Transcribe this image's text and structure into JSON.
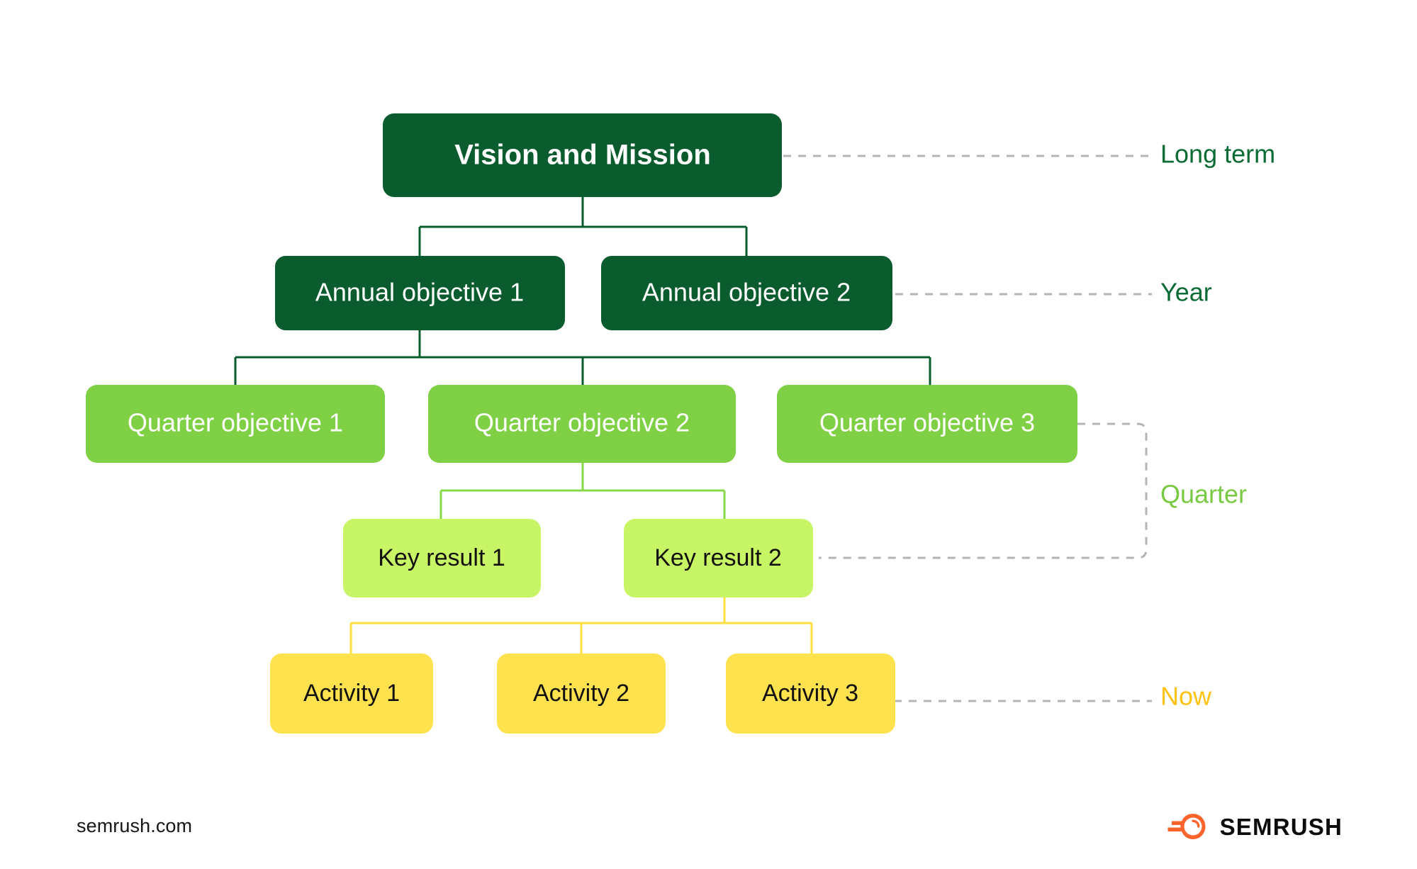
{
  "diagram": {
    "title_semantics": "OKR cascade hierarchy",
    "levels": [
      {
        "id": "vision",
        "time_label": "Long term",
        "label_color": "#0a6b34",
        "box_fill": "#0a5c2e",
        "text_color": "#ffffff",
        "nodes": [
          {
            "label": "Vision and Mission"
          }
        ]
      },
      {
        "id": "annual",
        "time_label": "Year",
        "label_color": "#0a6b34",
        "box_fill": "#0a5c2e",
        "text_color": "#ffffff",
        "nodes": [
          {
            "label": "Annual objective 1"
          },
          {
            "label": "Annual objective 2"
          }
        ]
      },
      {
        "id": "quarter",
        "time_label": "Quarter",
        "label_color": "#7ac943",
        "box_fill": "#80d046",
        "text_color": "#ffffff",
        "nodes": [
          {
            "label": "Quarter objective 1"
          },
          {
            "label": "Quarter objective 2"
          },
          {
            "label": "Quarter objective 3"
          }
        ]
      },
      {
        "id": "key-result",
        "time_label": "",
        "label_color": "#7ac943",
        "box_fill": "#c8f566",
        "text_color": "#12100c",
        "nodes": [
          {
            "label": "Key result 1"
          },
          {
            "label": "Key result 2"
          }
        ]
      },
      {
        "id": "activity",
        "time_label": "Now",
        "label_color": "#ffc20e",
        "box_fill": "#ffe24d",
        "text_color": "#12100c",
        "nodes": [
          {
            "label": "Activity 1"
          },
          {
            "label": "Activity 2"
          },
          {
            "label": "Activity 3"
          }
        ]
      }
    ],
    "side_labels": [
      {
        "text": "Long term",
        "color": "#0a6b34"
      },
      {
        "text": "Year",
        "color": "#0a6b34"
      },
      {
        "text": "Quarter",
        "color": "#7ac943"
      },
      {
        "text": "Now",
        "color": "#ffc20e"
      }
    ],
    "connector_colors": {
      "dark_green": "#0a5c2e",
      "green": "#86d84a",
      "yellow": "#ffdf3f",
      "dashed_gray": "#b4b4b4"
    }
  },
  "footer": {
    "url": "semrush.com",
    "brand": "SEMRUSH",
    "brand_color": "#ff642d"
  }
}
